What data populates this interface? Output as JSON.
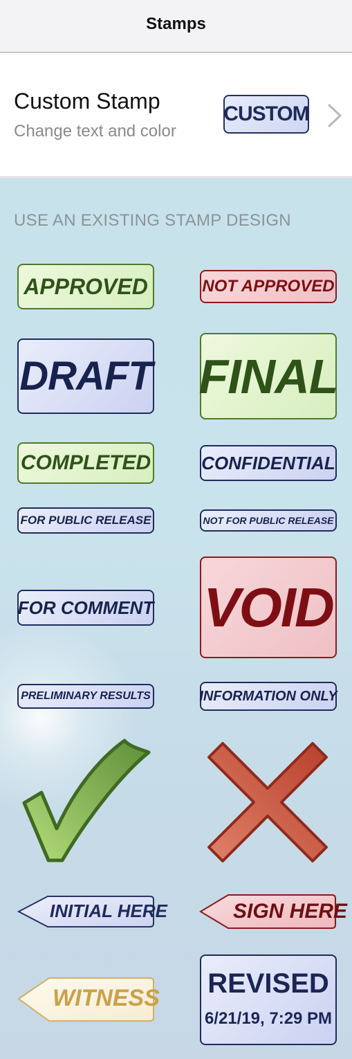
{
  "navbar": {
    "title": "Stamps"
  },
  "custom": {
    "title": "Custom Stamp",
    "subtitle": "Change text and color",
    "preview_label": "CUSTOM"
  },
  "section": {
    "header": "USE AN EXISTING STAMP DESIGN"
  },
  "stamps": {
    "approved": "APPROVED",
    "not_approved": "NOT APPROVED",
    "draft": "DRAFT",
    "final": "FINAL",
    "completed": "COMPLETED",
    "confidential": "CONFIDENTIAL",
    "for_public_release": "FOR PUBLIC RELEASE",
    "not_for_public_release": "NOT FOR PUBLIC RELEASE",
    "for_comment": "FOR COMMENT",
    "void": "VOID",
    "preliminary_results": "PRELIMINARY RESULTS",
    "information_only": "INFORMATION ONLY",
    "checkmark": "checkmark-icon",
    "cross": "x-mark-icon",
    "initial_here": "INITIAL HERE",
    "sign_here": "SIGN HERE",
    "witness": "WITNESS",
    "revised": "REVISED",
    "revised_date": "6/21/19, 7:29 PM"
  },
  "colors": {
    "green_text": "#2f5219",
    "red_text": "#7d0f14",
    "blue_text": "#17224e",
    "witness_text": "#c9a14a"
  }
}
